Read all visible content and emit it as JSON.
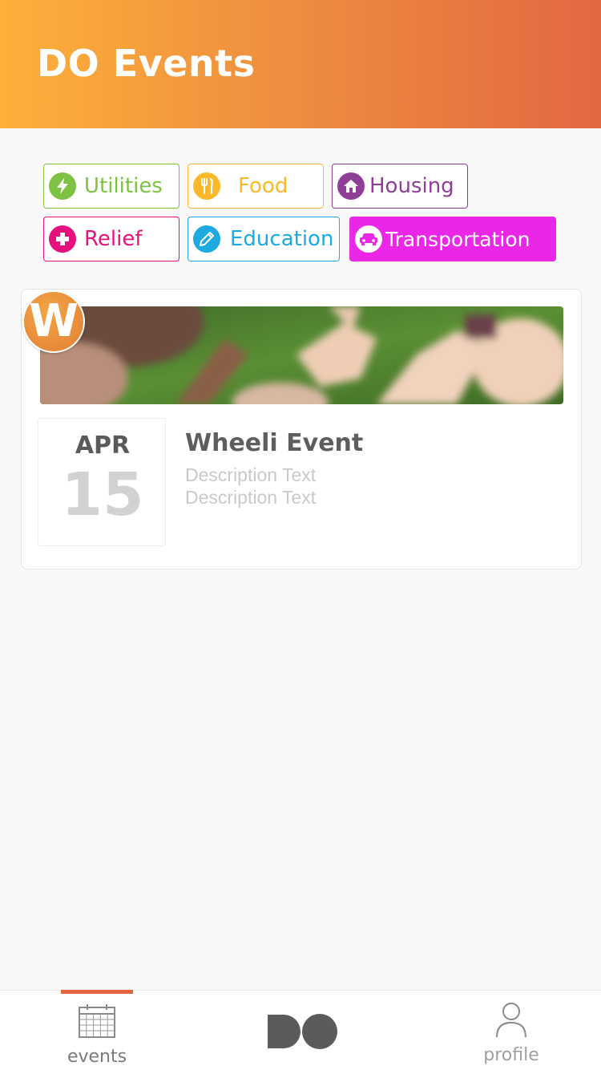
{
  "header": {
    "title": "DO Events"
  },
  "filters": [
    {
      "label": "Utilities",
      "icon": "lightning-icon",
      "color": "#7dc242",
      "active": false
    },
    {
      "label": "Food",
      "icon": "utensils-icon",
      "color": "#fbb82b",
      "active": false
    },
    {
      "label": "Housing",
      "icon": "house-icon",
      "color": "#8f3e97",
      "active": false
    },
    {
      "label": "Relief",
      "icon": "plus-icon",
      "color": "#e5127d",
      "active": false
    },
    {
      "label": "Education",
      "icon": "pencil-icon",
      "color": "#1ea9e1",
      "active": false
    },
    {
      "label": "Transportation",
      "icon": "car-icon",
      "color": "#ea27e6",
      "active": true
    }
  ],
  "event": {
    "org_badge_letter": "W",
    "month": "APR",
    "day": "15",
    "title": "Wheeli Event",
    "description_lines": [
      "Description Text",
      "Description Text"
    ]
  },
  "tabbar": {
    "events_label": "events",
    "center_logo": "DO",
    "profile_label": "profile",
    "active_tab": "events"
  }
}
